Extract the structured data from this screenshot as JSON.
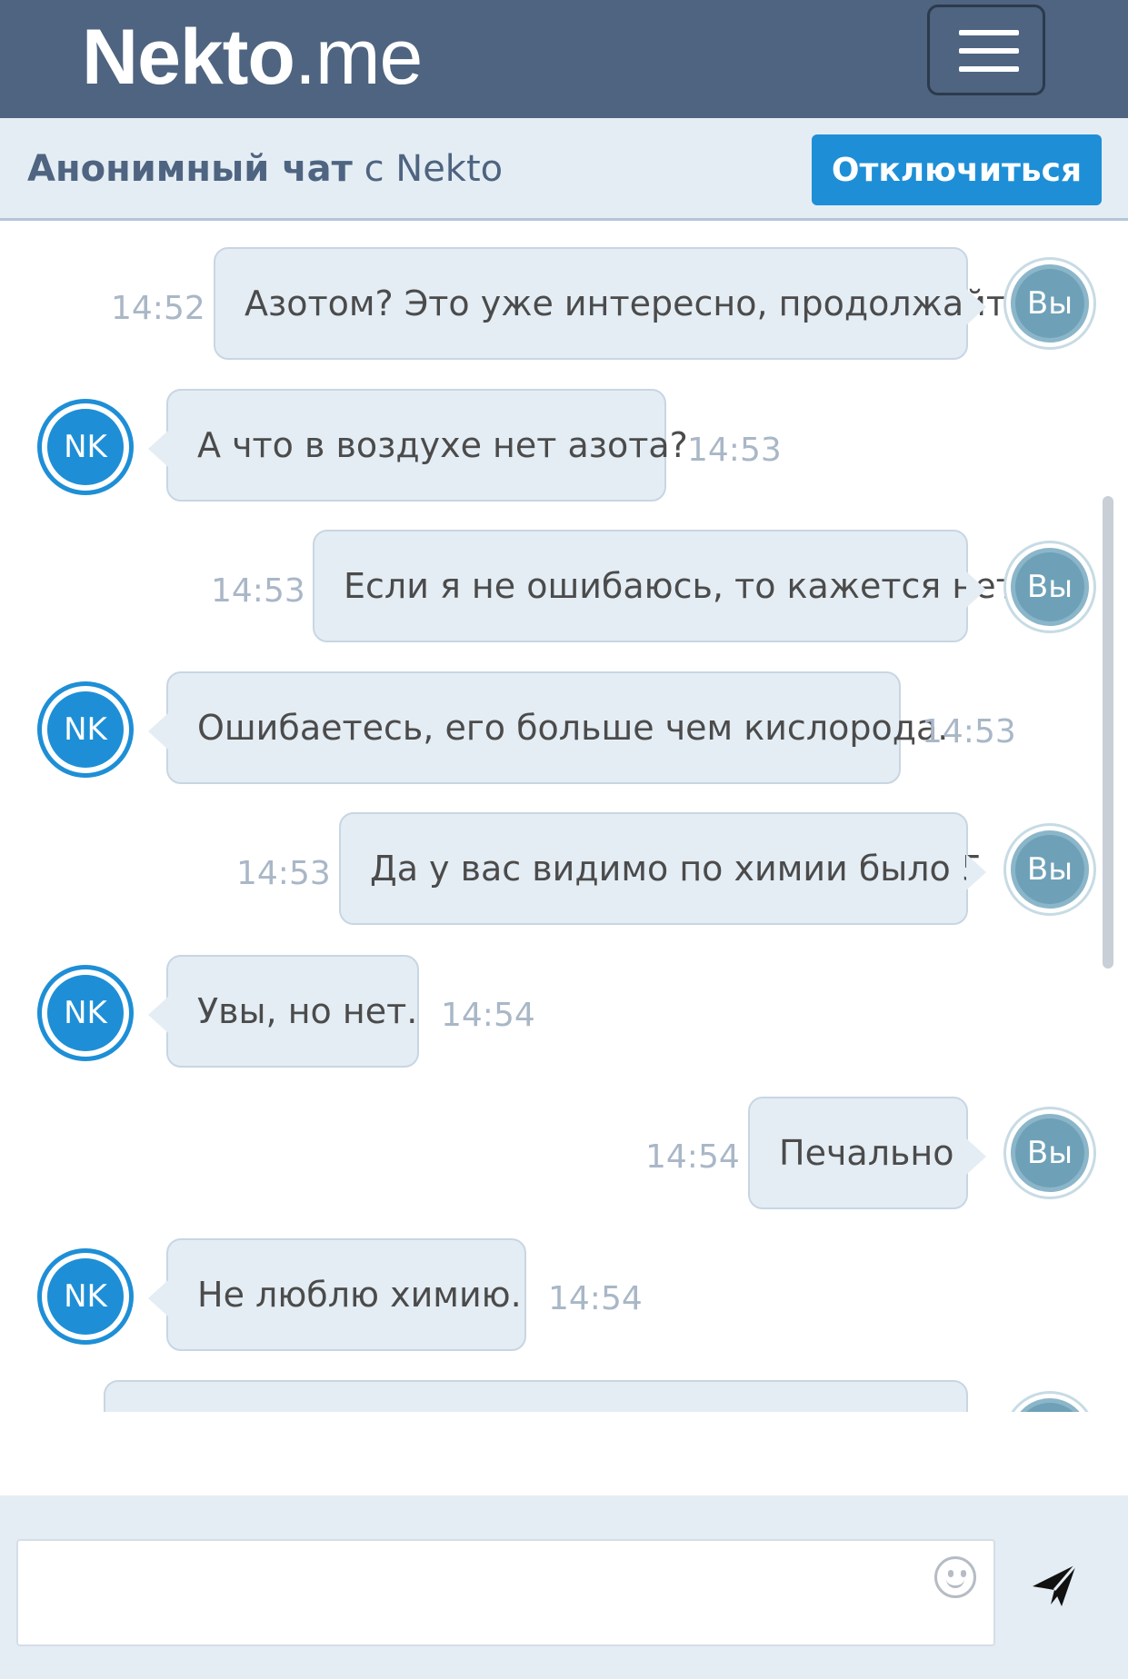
{
  "header": {
    "brand_bold": "Nekto",
    "brand_light": ".me",
    "menu_icon": "hamburger-icon"
  },
  "subheader": {
    "title_bold": "Анонимный чат",
    "title_light": "с Nekto",
    "disconnect_label": "Отключиться"
  },
  "messages": [
    {
      "from": "you",
      "text": "Азотом? Это уже интересно, продолжайте",
      "time": "14:52",
      "avatar": "Вы"
    },
    {
      "from": "nekto",
      "text": "А что в воздухе нет азота?",
      "time": "14:53",
      "avatar": "NK"
    },
    {
      "from": "you",
      "text": "Если я не ошибаюсь, то кажется нет",
      "time": "14:53",
      "avatar": "Вы"
    },
    {
      "from": "nekto",
      "text": "Ошибаетесь, его больше чем кислорода.",
      "time": "14:53",
      "avatar": "NK"
    },
    {
      "from": "you",
      "text": "Да у вас видимо по химии было 5",
      "time": "14:53",
      "avatar": "Вы"
    },
    {
      "from": "nekto",
      "text": "Увы, но нет.",
      "time": "14:54",
      "avatar": "NK"
    },
    {
      "from": "you",
      "text": "Печально",
      "time": "14:54",
      "avatar": "Вы"
    },
    {
      "from": "nekto",
      "text": "Не люблю химию.",
      "time": "14:54",
      "avatar": "NK"
    }
  ],
  "composer": {
    "value": "",
    "emoji_icon": "emoji-smile-icon",
    "send_icon": "send-paper-plane-icon"
  },
  "colors": {
    "navbar": "#4e6480",
    "accent": "#1e8fd6",
    "bubble": "#e4edf4",
    "timestamp": "#a9b7c7"
  }
}
